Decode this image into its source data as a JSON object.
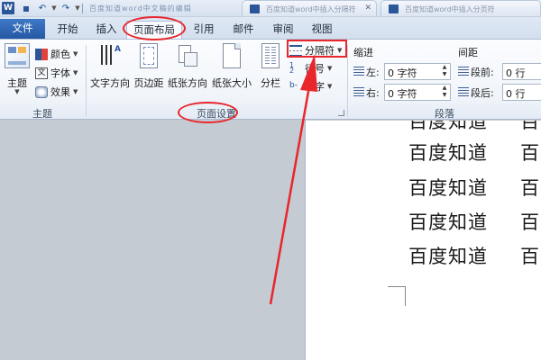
{
  "titlebar": {
    "logo": "W",
    "title_text": "百度知道word中文稿的编辑",
    "tab1_text": "百度知道word中插入分隔符",
    "tab2_text": "百度知道word中插入分页符"
  },
  "tabs": {
    "file": "文件",
    "home": "开始",
    "insert": "插入",
    "page_layout": "页面布局",
    "references": "引用",
    "mailings": "邮件",
    "review": "审阅",
    "view": "视图"
  },
  "ribbon": {
    "themes": {
      "theme_btn": "主题",
      "colors": "颜色",
      "fonts": "字体",
      "effects": "效果",
      "group_label": "主题"
    },
    "page_setup": {
      "text_direction": "文字方向",
      "margins": "页边距",
      "orientation": "纸张方向",
      "size": "纸张大小",
      "columns": "分栏",
      "breaks": "分隔符",
      "line_numbers": "行号",
      "hyphenation": "断字",
      "group_label": "页面设置"
    },
    "paragraph": {
      "indent_title": "缩进",
      "left_label": "左:",
      "left_value": "0 字符",
      "right_label": "右:",
      "right_value": "0 字符",
      "spacing_title": "间距",
      "before_label": "段前:",
      "before_value": "0 行",
      "after_label": "段后:",
      "after_value": "0 行",
      "group_label": "段落"
    }
  },
  "document": {
    "lines": [
      "百度知道",
      "百度知道",
      "百度知道",
      "百度知道",
      "百度知道"
    ],
    "col2": [
      "百",
      "百",
      "百",
      "百",
      "百"
    ]
  },
  "colors": {
    "annotation": "#e8262c",
    "file_tab": "#2b579a"
  }
}
